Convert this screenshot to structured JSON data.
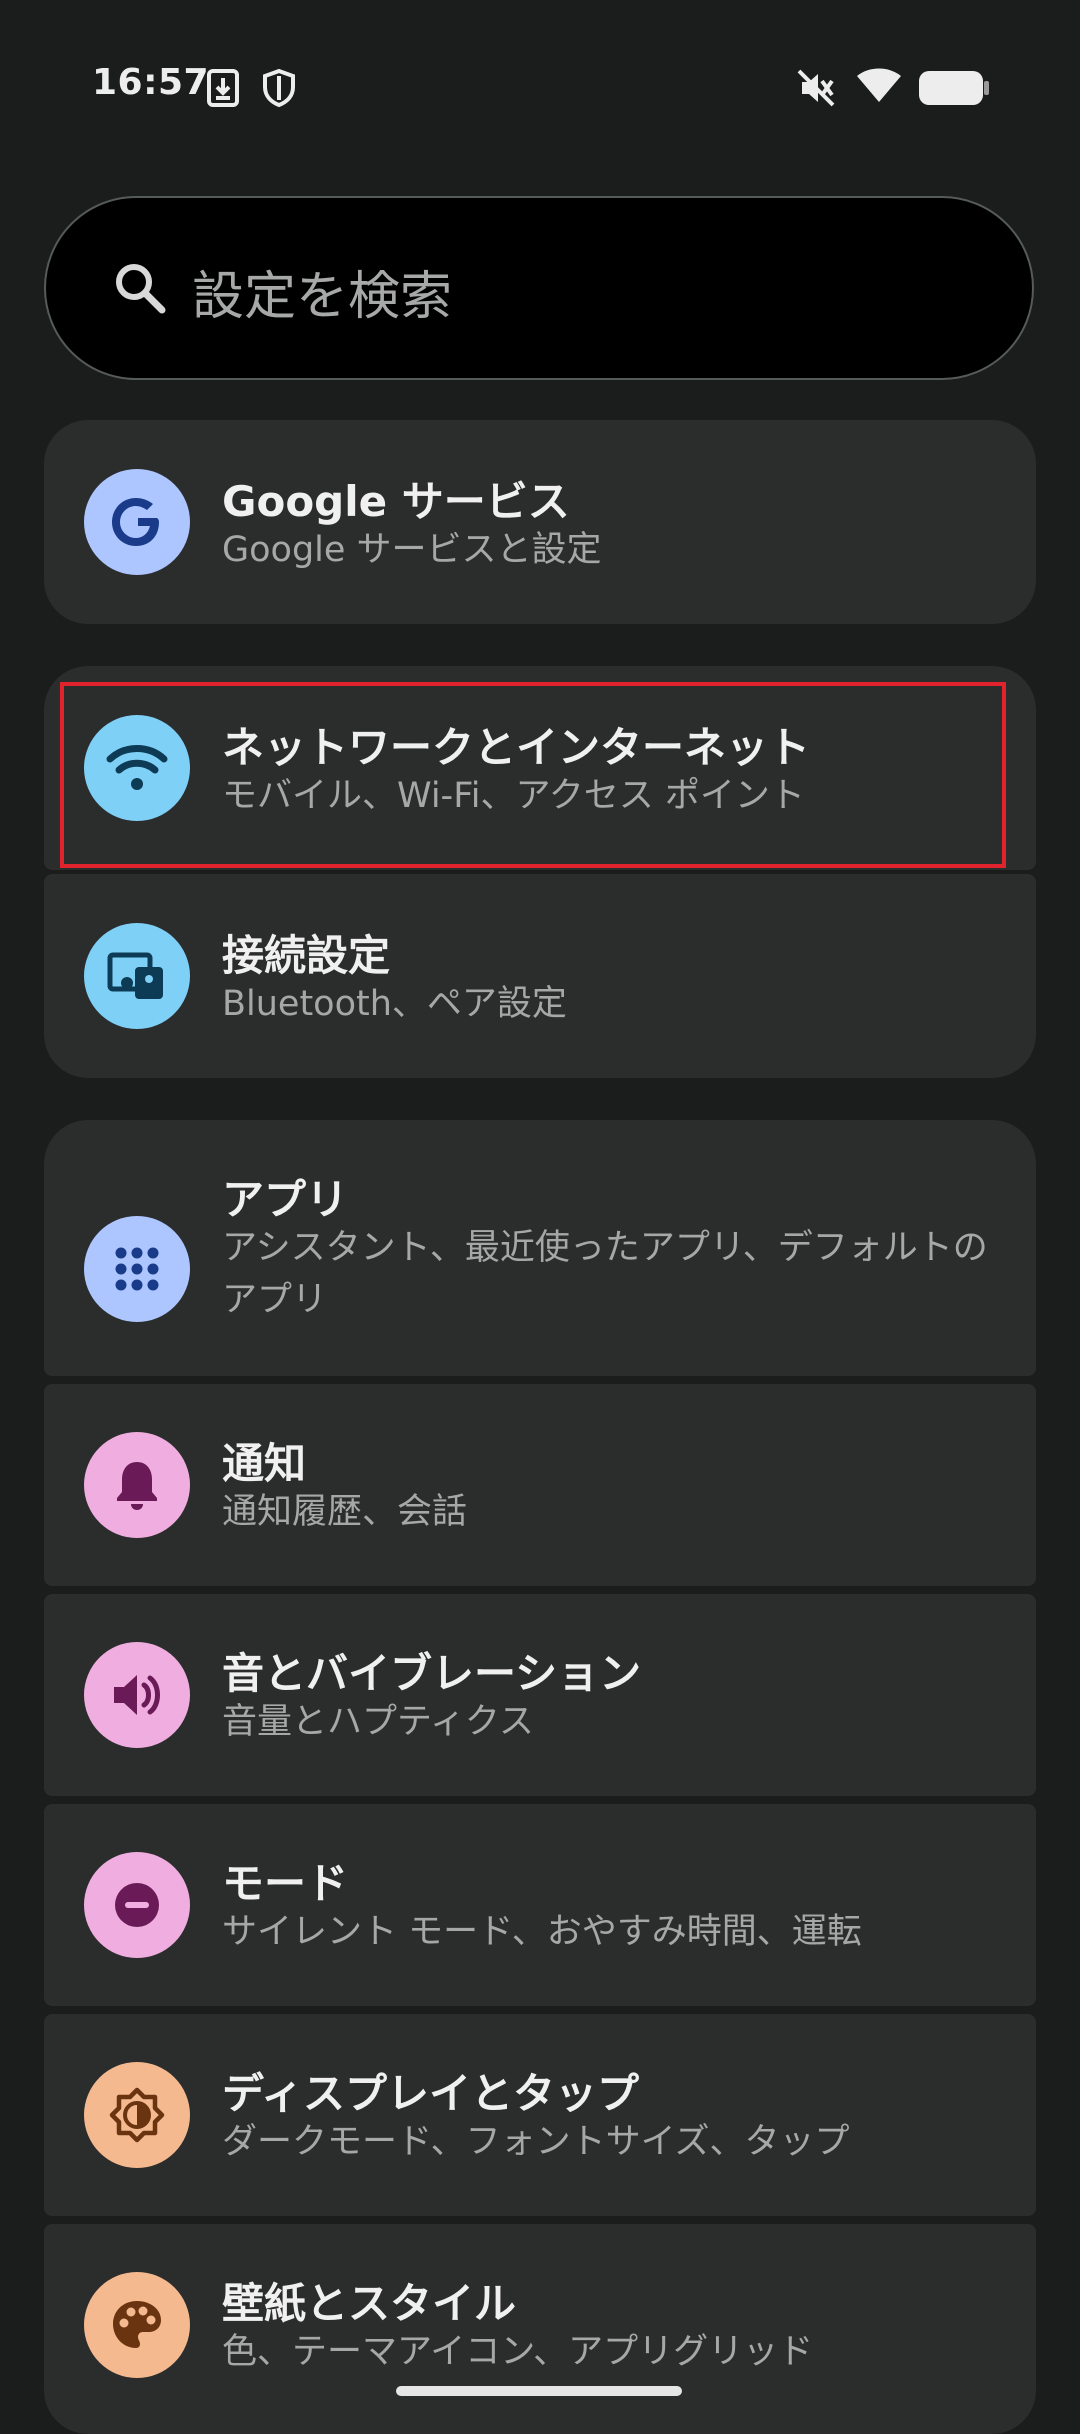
{
  "status_bar": {
    "time": "16:57",
    "icons": [
      "download-icon",
      "shield-icon",
      "mute-vibrate-icon",
      "wifi-icon",
      "battery-icon"
    ]
  },
  "search": {
    "placeholder": "設定を検索"
  },
  "items": [
    {
      "title": "Google サービス",
      "subtitle": "Google サービスと設定",
      "icon": "google-icon",
      "icon_bg": "#adc6ff",
      "icon_fg": "#1a3a8a"
    },
    {
      "title": "ネットワークとインターネット",
      "subtitle": "モバイル、Wi-Fi、アクセス ポイント",
      "icon": "wifi-icon",
      "icon_bg": "#7fd0f7",
      "icon_fg": "#0d3b55",
      "highlighted": true
    },
    {
      "title": "接続設定",
      "subtitle": "Bluetooth、ペア設定",
      "icon": "connected-devices-icon",
      "icon_bg": "#7fd0f7",
      "icon_fg": "#0d3b55"
    },
    {
      "title": "アプリ",
      "subtitle": "アシスタント、最近使ったアプリ、デフォルトのアプリ",
      "icon": "apps-grid-icon",
      "icon_bg": "#adc6ff",
      "icon_fg": "#1a3a8a"
    },
    {
      "title": "通知",
      "subtitle": "通知履歴、会話",
      "icon": "bell-icon",
      "icon_bg": "#f0aee0",
      "icon_fg": "#6a1a56"
    },
    {
      "title": "音とバイブレーション",
      "subtitle": "音量とハプティクス",
      "icon": "speaker-icon",
      "icon_bg": "#f0aee0",
      "icon_fg": "#6a1a56"
    },
    {
      "title": "モード",
      "subtitle": "サイレント モード、おやすみ時間、運転",
      "icon": "do-not-disturb-icon",
      "icon_bg": "#f0aee0",
      "icon_fg": "#6a1a56"
    },
    {
      "title": "ディスプレイとタップ",
      "subtitle": "ダークモード、フォントサイズ、タップ",
      "icon": "brightness-icon",
      "icon_bg": "#f5b98f",
      "icon_fg": "#6a3410"
    },
    {
      "title": "壁紙とスタイル",
      "subtitle": "色、テーマアイコン、アプリグリッド",
      "icon": "palette-icon",
      "icon_bg": "#f5b98f",
      "icon_fg": "#6a3410"
    }
  ]
}
